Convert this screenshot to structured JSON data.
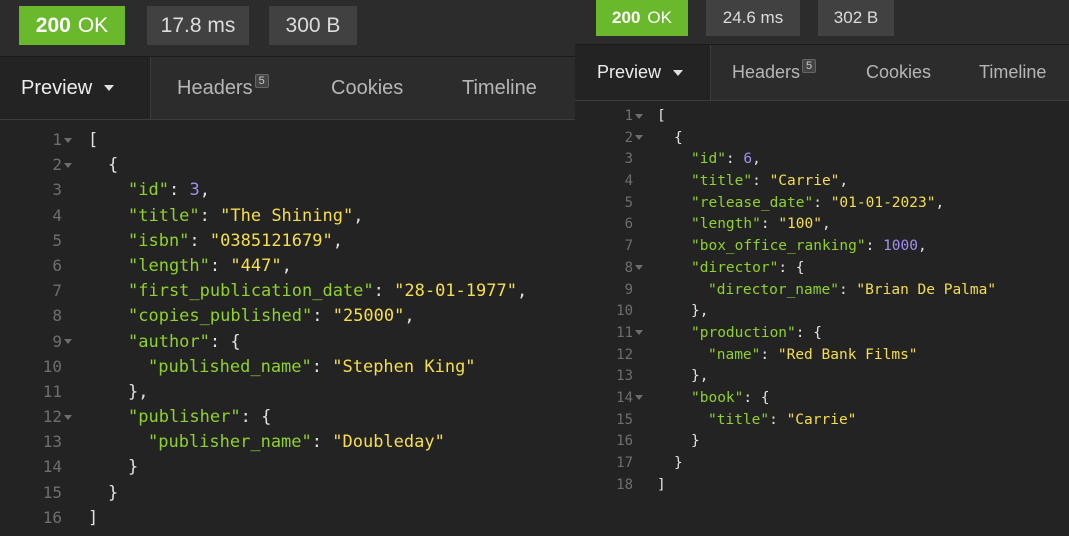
{
  "left": {
    "status": {
      "code": "200",
      "text": "OK",
      "time": "17.8 ms",
      "size": "300 B"
    },
    "tabs": {
      "preview": "Preview",
      "headers": "Headers",
      "headers_count": "5",
      "cookies": "Cookies",
      "timeline": "Timeline"
    },
    "lines": [
      {
        "n": "1",
        "fold": true,
        "indent": 0,
        "parts": [
          [
            "p",
            "["
          ]
        ]
      },
      {
        "n": "2",
        "fold": true,
        "indent": 1,
        "parts": [
          [
            "p",
            "{"
          ]
        ]
      },
      {
        "n": "3",
        "fold": false,
        "indent": 2,
        "parts": [
          [
            "k",
            "\"id\""
          ],
          [
            "p",
            ": "
          ],
          [
            "n",
            "3"
          ],
          [
            "p",
            ","
          ]
        ]
      },
      {
        "n": "4",
        "fold": false,
        "indent": 2,
        "parts": [
          [
            "k",
            "\"title\""
          ],
          [
            "p",
            ": "
          ],
          [
            "s",
            "\"The Shining\""
          ],
          [
            "p",
            ","
          ]
        ]
      },
      {
        "n": "5",
        "fold": false,
        "indent": 2,
        "parts": [
          [
            "k",
            "\"isbn\""
          ],
          [
            "p",
            ": "
          ],
          [
            "s",
            "\"0385121679\""
          ],
          [
            "p",
            ","
          ]
        ]
      },
      {
        "n": "6",
        "fold": false,
        "indent": 2,
        "parts": [
          [
            "k",
            "\"length\""
          ],
          [
            "p",
            ": "
          ],
          [
            "s",
            "\"447\""
          ],
          [
            "p",
            ","
          ]
        ]
      },
      {
        "n": "7",
        "fold": false,
        "indent": 2,
        "parts": [
          [
            "k",
            "\"first_publication_date\""
          ],
          [
            "p",
            ": "
          ],
          [
            "s",
            "\"28-01-1977\""
          ],
          [
            "p",
            ","
          ]
        ]
      },
      {
        "n": "8",
        "fold": false,
        "indent": 2,
        "parts": [
          [
            "k",
            "\"copies_published\""
          ],
          [
            "p",
            ": "
          ],
          [
            "s",
            "\"25000\""
          ],
          [
            "p",
            ","
          ]
        ]
      },
      {
        "n": "9",
        "fold": true,
        "indent": 2,
        "parts": [
          [
            "k",
            "\"author\""
          ],
          [
            "p",
            ": {"
          ]
        ]
      },
      {
        "n": "10",
        "fold": false,
        "indent": 3,
        "parts": [
          [
            "k",
            "\"published_name\""
          ],
          [
            "p",
            ": "
          ],
          [
            "s",
            "\"Stephen King\""
          ]
        ]
      },
      {
        "n": "11",
        "fold": false,
        "indent": 2,
        "parts": [
          [
            "p",
            "},"
          ]
        ]
      },
      {
        "n": "12",
        "fold": true,
        "indent": 2,
        "parts": [
          [
            "k",
            "\"publisher\""
          ],
          [
            "p",
            ": {"
          ]
        ]
      },
      {
        "n": "13",
        "fold": false,
        "indent": 3,
        "parts": [
          [
            "k",
            "\"publisher_name\""
          ],
          [
            "p",
            ": "
          ],
          [
            "s",
            "\"Doubleday\""
          ]
        ]
      },
      {
        "n": "14",
        "fold": false,
        "indent": 2,
        "parts": [
          [
            "p",
            "}"
          ]
        ]
      },
      {
        "n": "15",
        "fold": false,
        "indent": 1,
        "parts": [
          [
            "p",
            "}"
          ]
        ]
      },
      {
        "n": "16",
        "fold": false,
        "indent": 0,
        "parts": [
          [
            "p",
            "]"
          ]
        ]
      }
    ]
  },
  "right": {
    "status": {
      "code": "200",
      "text": "OK",
      "time": "24.6 ms",
      "size": "302 B"
    },
    "tabs": {
      "preview": "Preview",
      "headers": "Headers",
      "headers_count": "5",
      "cookies": "Cookies",
      "timeline": "Timeline"
    },
    "lines": [
      {
        "n": "1",
        "fold": true,
        "indent": 0,
        "parts": [
          [
            "p",
            "["
          ]
        ]
      },
      {
        "n": "2",
        "fold": true,
        "indent": 1,
        "parts": [
          [
            "p",
            "{"
          ]
        ]
      },
      {
        "n": "3",
        "fold": false,
        "indent": 2,
        "parts": [
          [
            "k",
            "\"id\""
          ],
          [
            "p",
            ": "
          ],
          [
            "n",
            "6"
          ],
          [
            "p",
            ","
          ]
        ]
      },
      {
        "n": "4",
        "fold": false,
        "indent": 2,
        "parts": [
          [
            "k",
            "\"title\""
          ],
          [
            "p",
            ": "
          ],
          [
            "s",
            "\"Carrie\""
          ],
          [
            "p",
            ","
          ]
        ]
      },
      {
        "n": "5",
        "fold": false,
        "indent": 2,
        "parts": [
          [
            "k",
            "\"release_date\""
          ],
          [
            "p",
            ": "
          ],
          [
            "s",
            "\"01-01-2023\""
          ],
          [
            "p",
            ","
          ]
        ]
      },
      {
        "n": "6",
        "fold": false,
        "indent": 2,
        "parts": [
          [
            "k",
            "\"length\""
          ],
          [
            "p",
            ": "
          ],
          [
            "s",
            "\"100\""
          ],
          [
            "p",
            ","
          ]
        ]
      },
      {
        "n": "7",
        "fold": false,
        "indent": 2,
        "parts": [
          [
            "k",
            "\"box_office_ranking\""
          ],
          [
            "p",
            ": "
          ],
          [
            "n",
            "1000"
          ],
          [
            "p",
            ","
          ]
        ]
      },
      {
        "n": "8",
        "fold": true,
        "indent": 2,
        "parts": [
          [
            "k",
            "\"director\""
          ],
          [
            "p",
            ": {"
          ]
        ]
      },
      {
        "n": "9",
        "fold": false,
        "indent": 3,
        "parts": [
          [
            "k",
            "\"director_name\""
          ],
          [
            "p",
            ": "
          ],
          [
            "s",
            "\"Brian De Palma\""
          ]
        ]
      },
      {
        "n": "10",
        "fold": false,
        "indent": 2,
        "parts": [
          [
            "p",
            "},"
          ]
        ]
      },
      {
        "n": "11",
        "fold": true,
        "indent": 2,
        "parts": [
          [
            "k",
            "\"production\""
          ],
          [
            "p",
            ": {"
          ]
        ]
      },
      {
        "n": "12",
        "fold": false,
        "indent": 3,
        "parts": [
          [
            "k",
            "\"name\""
          ],
          [
            "p",
            ": "
          ],
          [
            "s",
            "\"Red Bank Films\""
          ]
        ]
      },
      {
        "n": "13",
        "fold": false,
        "indent": 2,
        "parts": [
          [
            "p",
            "},"
          ]
        ]
      },
      {
        "n": "14",
        "fold": true,
        "indent": 2,
        "parts": [
          [
            "k",
            "\"book\""
          ],
          [
            "p",
            ": {"
          ]
        ]
      },
      {
        "n": "15",
        "fold": false,
        "indent": 3,
        "parts": [
          [
            "k",
            "\"title\""
          ],
          [
            "p",
            ": "
          ],
          [
            "s",
            "\"Carrie\""
          ]
        ]
      },
      {
        "n": "16",
        "fold": false,
        "indent": 2,
        "parts": [
          [
            "p",
            "}"
          ]
        ]
      },
      {
        "n": "17",
        "fold": false,
        "indent": 1,
        "parts": [
          [
            "p",
            "}"
          ]
        ]
      },
      {
        "n": "18",
        "fold": false,
        "indent": 0,
        "parts": [
          [
            "p",
            "]"
          ]
        ]
      }
    ]
  },
  "colors": {
    "status_ok": "#6ab82b",
    "json_key": "#8fd22c",
    "json_string": "#f5df4d",
    "json_number": "#a28ff2"
  }
}
